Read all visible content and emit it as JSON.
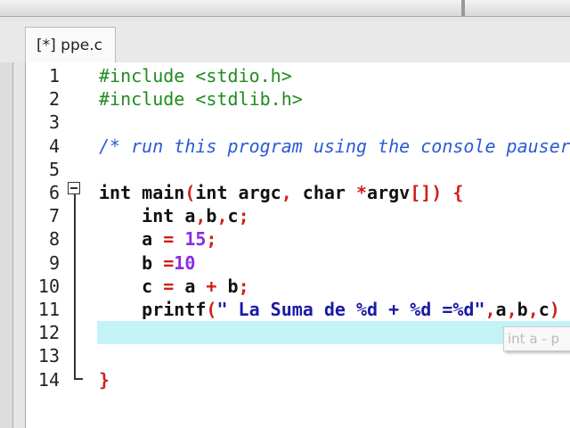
{
  "tab": {
    "label": "[*] ppe.c"
  },
  "editor": {
    "current_line": 12,
    "lines": [
      {
        "num": "1",
        "tokens": [
          {
            "t": "#include <stdio.h>",
            "c": "pp"
          }
        ]
      },
      {
        "num": "2",
        "tokens": [
          {
            "t": "#include <stdlib.h>",
            "c": "pp"
          }
        ]
      },
      {
        "num": "3",
        "tokens": []
      },
      {
        "num": "4",
        "tokens": [
          {
            "t": "/* run this program using the console pauser",
            "c": "c"
          }
        ]
      },
      {
        "num": "5",
        "tokens": []
      },
      {
        "num": "6",
        "tokens": [
          {
            "t": "int main",
            "c": "k"
          },
          {
            "t": "(",
            "c": "p"
          },
          {
            "t": "int argc",
            "c": "k"
          },
          {
            "t": ",",
            "c": "p"
          },
          {
            "t": " char ",
            "c": "k"
          },
          {
            "t": "*",
            "c": "p"
          },
          {
            "t": "argv",
            "c": "k"
          },
          {
            "t": "[]) {",
            "c": "p"
          }
        ]
      },
      {
        "num": "7",
        "tokens": [
          {
            "t": "    int a",
            "c": "k"
          },
          {
            "t": ",",
            "c": "p"
          },
          {
            "t": "b",
            "c": "k"
          },
          {
            "t": ",",
            "c": "p"
          },
          {
            "t": "c",
            "c": "k"
          },
          {
            "t": ";",
            "c": "p"
          }
        ]
      },
      {
        "num": "8",
        "tokens": [
          {
            "t": "    a ",
            "c": "k"
          },
          {
            "t": "=",
            "c": "p"
          },
          {
            "t": " 15",
            "c": "n"
          },
          {
            "t": ";",
            "c": "p"
          }
        ]
      },
      {
        "num": "9",
        "tokens": [
          {
            "t": "    b ",
            "c": "k"
          },
          {
            "t": "=",
            "c": "p"
          },
          {
            "t": "10",
            "c": "n"
          }
        ]
      },
      {
        "num": "10",
        "tokens": [
          {
            "t": "    c ",
            "c": "k"
          },
          {
            "t": "=",
            "c": "p"
          },
          {
            "t": " a ",
            "c": "k"
          },
          {
            "t": "+",
            "c": "p"
          },
          {
            "t": " b",
            "c": "k"
          },
          {
            "t": ";",
            "c": "p"
          }
        ]
      },
      {
        "num": "11",
        "tokens": [
          {
            "t": "    printf",
            "c": "k"
          },
          {
            "t": "(",
            "c": "p"
          },
          {
            "t": "\" La Suma de %d + %d =%d\"",
            "c": "s"
          },
          {
            "t": ",",
            "c": "p"
          },
          {
            "t": "a",
            "c": "k"
          },
          {
            "t": ",",
            "c": "p"
          },
          {
            "t": "b",
            "c": "k"
          },
          {
            "t": ",",
            "c": "p"
          },
          {
            "t": "c",
            "c": "k"
          },
          {
            "t": ")",
            "c": "p"
          }
        ]
      },
      {
        "num": "12",
        "tokens": []
      },
      {
        "num": "13",
        "tokens": []
      },
      {
        "num": "14",
        "tokens": [
          {
            "t": "}",
            "c": "p"
          }
        ]
      }
    ]
  },
  "tooltip": {
    "text": "int a - p"
  }
}
